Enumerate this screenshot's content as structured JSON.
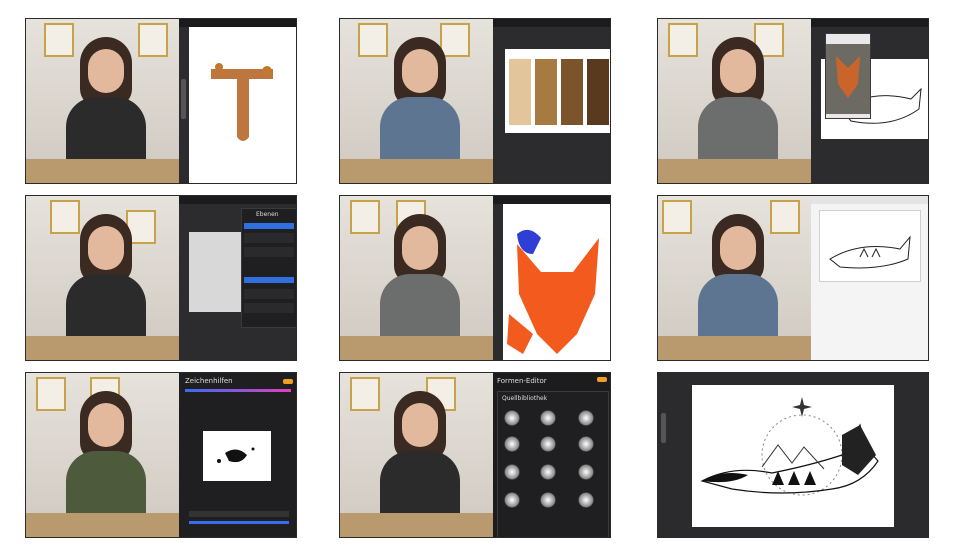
{
  "collage": {
    "tiles": [
      {
        "screen_text": ""
      },
      {
        "screen_text": ""
      },
      {
        "screen_text": ""
      },
      {
        "screen_text": "Ebenen"
      },
      {
        "screen_text": ""
      },
      {
        "screen_text": ""
      },
      {
        "screen_text": "Zeichenhilfen"
      },
      {
        "screen_text": "Formen-Editor",
        "panel_title": "Quellbibliothek"
      },
      {
        "screen_text": ""
      }
    ]
  },
  "colors": {
    "fox_orange": "#f25a1e",
    "highlight_blue": "#2f6fe0",
    "stain_brown": "#b7672a"
  }
}
